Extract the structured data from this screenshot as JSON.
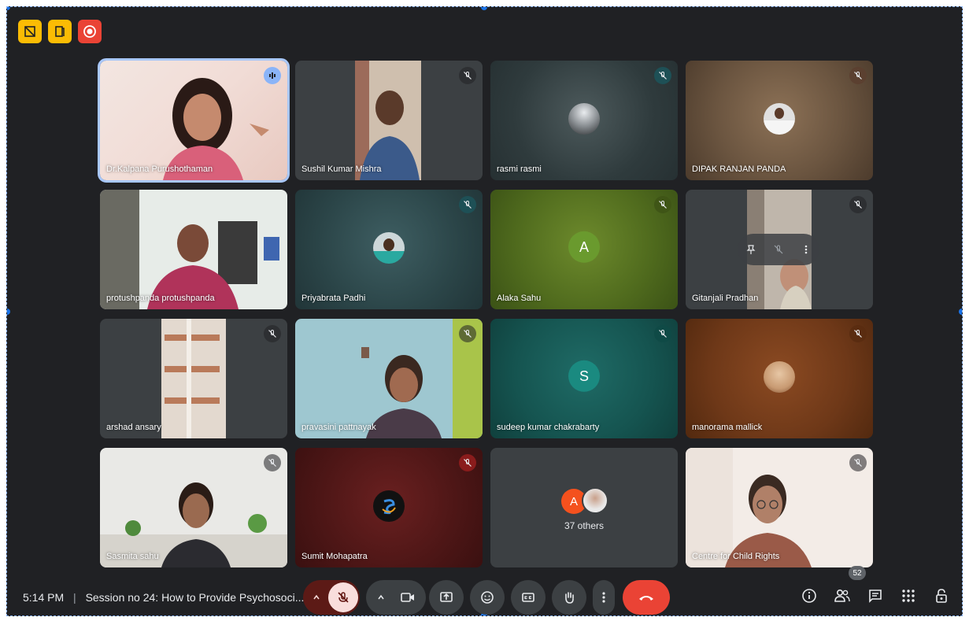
{
  "meeting": {
    "time": "5:14 PM",
    "separator": "|",
    "title": "Session no 24: How to Provide Psychosoci..."
  },
  "participants": [
    {
      "name": "Dr.Kalpana Purushothaman",
      "mic": "speaking",
      "style": "video"
    },
    {
      "name": "Sushil Kumar Mishra",
      "mic": "muted",
      "style": "video"
    },
    {
      "name": "rasmi rasmi",
      "mic": "muted",
      "style": "avatar"
    },
    {
      "name": "DIPAK RANJAN PANDA",
      "mic": "muted",
      "style": "avatar"
    },
    {
      "name": "protushpanda protushpanda",
      "mic": "none",
      "style": "video"
    },
    {
      "name": "Priyabrata Padhi",
      "mic": "muted",
      "style": "avatar"
    },
    {
      "name": "Alaka Sahu",
      "mic": "muted",
      "style": "letter",
      "initial": "A"
    },
    {
      "name": "Gitanjali Pradhan",
      "mic": "muted",
      "style": "video"
    },
    {
      "name": "arshad ansary",
      "mic": "muted",
      "style": "video"
    },
    {
      "name": "pravasini pattnayak",
      "mic": "muted",
      "style": "video"
    },
    {
      "name": "sudeep kumar chakrabarty",
      "mic": "muted",
      "style": "letter",
      "initial": "S"
    },
    {
      "name": "manorama mallick",
      "mic": "muted",
      "style": "avatar"
    },
    {
      "name": "Sasmita sahu",
      "mic": "muted",
      "style": "video"
    },
    {
      "name": "Sumit Mohapatra",
      "mic": "muted",
      "style": "avatar"
    },
    {
      "name": "",
      "mic": "none",
      "style": "others"
    },
    {
      "name": "Centre for Child Rights",
      "mic": "muted",
      "style": "video"
    }
  ],
  "others": {
    "initial": "A",
    "label": "37 others"
  },
  "people_count": "52",
  "colors": {
    "background": "#202124",
    "tile": "#3c4043",
    "end_call": "#ea4335",
    "active_speaker": "#a8c7fa",
    "host_controls": "#fbbc04"
  },
  "icons": {
    "top": [
      "host-controls-icon",
      "companion-icon",
      "record-icon"
    ],
    "controls": [
      "mic-off-icon",
      "camera-icon",
      "present-icon",
      "emoji-icon",
      "captions-icon",
      "raise-hand-icon",
      "more-icon",
      "end-call-icon"
    ],
    "right": [
      "info-icon",
      "people-icon",
      "chat-icon",
      "activities-icon",
      "lock-icon"
    ]
  }
}
